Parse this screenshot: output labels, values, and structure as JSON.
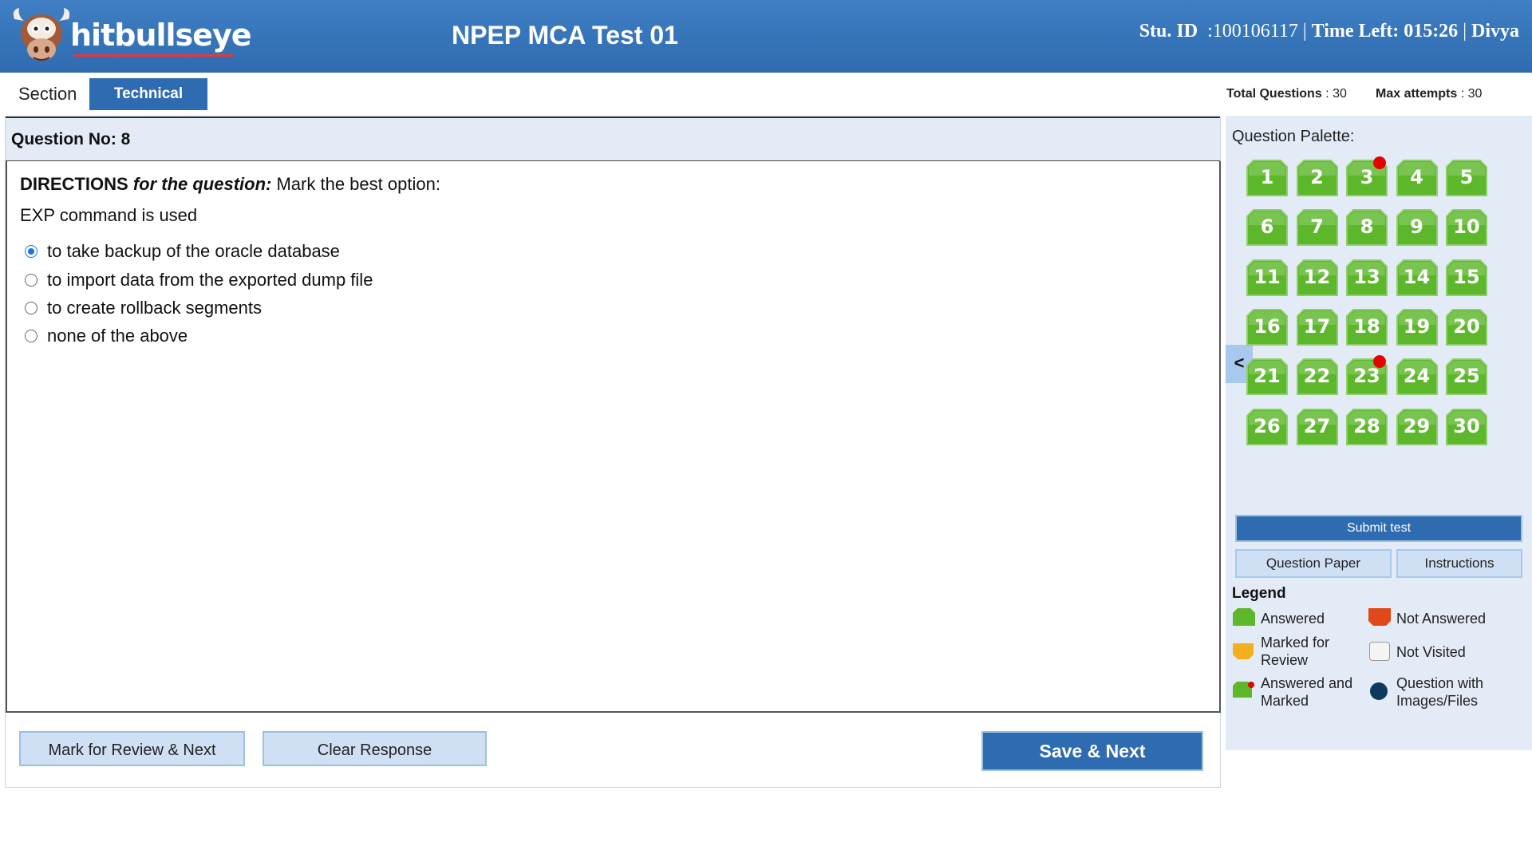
{
  "header": {
    "logo_text": "hitbullseye",
    "title": "NPEP MCA Test 01",
    "student_id_label": "Stu. ID",
    "student_id": ":100106117",
    "time_left_label": "Time Left:",
    "time_left": "015:26",
    "user_name": "Divya",
    "separator": "|"
  },
  "section": {
    "label": "Section",
    "active_tab": "Technical",
    "total_questions_label": "Total Questions",
    "total_questions": ": 30",
    "max_attempts_label": "Max attempts",
    "max_attempts": ": 30"
  },
  "question": {
    "number_label": "Question No: 8",
    "directions_bold": "DIRECTIONS",
    "directions_italic": "for the question:",
    "directions_text": "Mark the best option:",
    "text": "EXP command is used",
    "options": [
      {
        "label": "to take backup of the oracle database",
        "selected": true
      },
      {
        "label": "to import data from the exported dump file",
        "selected": false
      },
      {
        "label": "to create rollback segments",
        "selected": false
      },
      {
        "label": "none of the above",
        "selected": false
      }
    ]
  },
  "buttons": {
    "mark_review": "Mark for Review & Next",
    "clear": "Clear Response",
    "save_next": "Save & Next"
  },
  "palette": {
    "title": "Question Palette:",
    "collapse_glyph": "<",
    "questions": [
      {
        "n": "1",
        "state": "answered"
      },
      {
        "n": "2",
        "state": "answered"
      },
      {
        "n": "3",
        "state": "answered_marked"
      },
      {
        "n": "4",
        "state": "answered"
      },
      {
        "n": "5",
        "state": "answered"
      },
      {
        "n": "6",
        "state": "answered"
      },
      {
        "n": "7",
        "state": "answered"
      },
      {
        "n": "8",
        "state": "answered"
      },
      {
        "n": "9",
        "state": "answered"
      },
      {
        "n": "10",
        "state": "answered"
      },
      {
        "n": "11",
        "state": "answered"
      },
      {
        "n": "12",
        "state": "answered"
      },
      {
        "n": "13",
        "state": "answered"
      },
      {
        "n": "14",
        "state": "answered"
      },
      {
        "n": "15",
        "state": "answered"
      },
      {
        "n": "16",
        "state": "answered"
      },
      {
        "n": "17",
        "state": "answered"
      },
      {
        "n": "18",
        "state": "answered"
      },
      {
        "n": "19",
        "state": "answered"
      },
      {
        "n": "20",
        "state": "answered"
      },
      {
        "n": "21",
        "state": "answered"
      },
      {
        "n": "22",
        "state": "answered"
      },
      {
        "n": "23",
        "state": "answered_marked"
      },
      {
        "n": "24",
        "state": "answered"
      },
      {
        "n": "25",
        "state": "answered"
      },
      {
        "n": "26",
        "state": "answered"
      },
      {
        "n": "27",
        "state": "answered"
      },
      {
        "n": "28",
        "state": "answered"
      },
      {
        "n": "29",
        "state": "answered"
      },
      {
        "n": "30",
        "state": "answered"
      }
    ],
    "submit": "Submit test",
    "question_paper": "Question Paper",
    "instructions": "Instructions"
  },
  "legend": {
    "title": "Legend",
    "answered": "Answered",
    "not_answered": "Not Answered",
    "marked_review_1": "Marked for",
    "marked_review_2": "Review",
    "not_visited": "Not Visited",
    "answered_marked_1": "Answered and",
    "answered_marked_2": "Marked",
    "images_files_1": "Question with",
    "images_files_2": "Images/Files"
  },
  "colors": {
    "brand_blue": "#2f6bb0",
    "answered_green": "#5cb82a",
    "not_answered_red": "#e0481a",
    "review_orange": "#f2b01e",
    "marked_dot": "#e60000",
    "images_navy": "#0b3a5e"
  }
}
